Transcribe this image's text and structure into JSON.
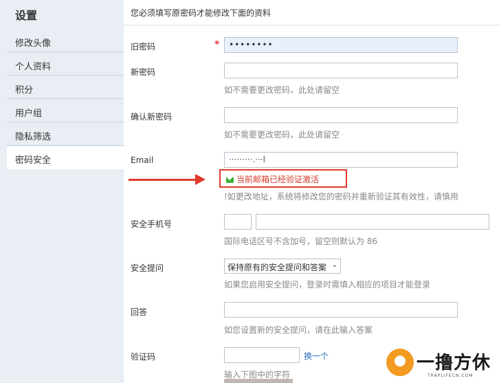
{
  "sidebar": {
    "title": "设置",
    "items": [
      {
        "label": "修改头像"
      },
      {
        "label": "个人资料"
      },
      {
        "label": "积分"
      },
      {
        "label": "用户组"
      },
      {
        "label": "隐私筛选"
      },
      {
        "label": "密码安全"
      }
    ],
    "active_index": 5
  },
  "form": {
    "intro": "您必须填写原密码才能修改下面的资料",
    "old_password": {
      "label": "旧密码",
      "required_mark": "*",
      "value": "••••••••"
    },
    "new_password": {
      "label": "新密码",
      "value": "",
      "hint": "如不需要更改密码，此处请留空"
    },
    "confirm_password": {
      "label": "确认新密码",
      "value": "",
      "hint": "如不需要更改密码，此处请留空"
    },
    "email": {
      "label": "Email",
      "value": "·········.···l",
      "verified_text": "当前邮箱已经验证激活",
      "hint": "!如更改地址，系统将修改您的密码并重新验证其有效性，请慎用"
    },
    "phone": {
      "label": "安全手机号",
      "country_code": "",
      "number": "",
      "hint": "国际电话区号不含加号，留空则默认为 86"
    },
    "security_question": {
      "label": "安全提问",
      "selected": "保持原有的安全提问和答案",
      "hint": "如果您启用安全提问，登录时需填入相应的项目才能登录"
    },
    "answer": {
      "label": "回答",
      "value": "",
      "hint": "如您设置新的安全提问，请在此输入答案"
    },
    "captcha": {
      "label": "验证码",
      "value": "",
      "refresh_link": "换一个",
      "hint": "输入下图中的字符"
    }
  },
  "watermark": {
    "text": "一撸方休",
    "sub": "TRAPLIFECN.COM"
  },
  "colors": {
    "accent_red": "#e0392d",
    "sidebar_bg": "#e8eef3",
    "link": "#2a6ebb",
    "verified_icon": "#3fb03a"
  }
}
